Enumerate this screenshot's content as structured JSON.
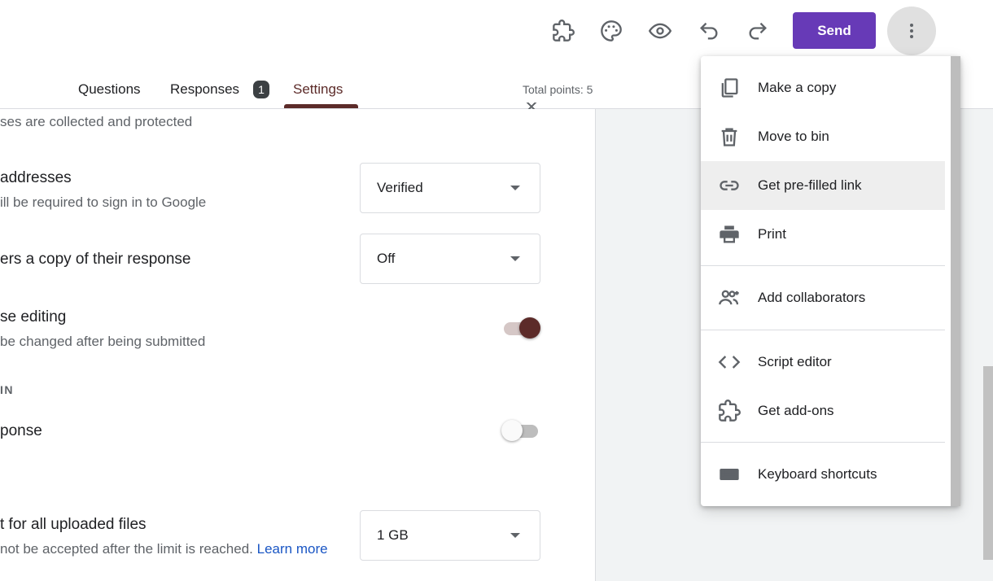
{
  "header": {
    "send_label": "Send",
    "icons": [
      "addons-icon",
      "palette-icon",
      "preview-icon",
      "undo-icon",
      "redo-icon",
      "more-vert-icon"
    ]
  },
  "tabs": [
    {
      "label": "Questions"
    },
    {
      "label": "Responses",
      "badge": "1"
    },
    {
      "label": "Settings",
      "active": true
    }
  ],
  "total_points": "Total points: 5",
  "settings": {
    "collect_sub": "ses are collected and protected",
    "email_title": "addresses",
    "email_sub": "ill be required to sign in to Google",
    "email_value": "Verified",
    "copy_title": "ers a copy of their response",
    "copy_value": "Off",
    "edit_title": "se editing",
    "edit_sub": " be changed after being submitted",
    "edit_on": true,
    "section_label": "IN",
    "response_title": "ponse",
    "response_on": false,
    "upload_title": "t for all uploaded files",
    "upload_sub": "not be accepted after the limit is reached.",
    "upload_link": "Learn more",
    "upload_value": "1 GB"
  },
  "menu": {
    "items": [
      {
        "label": "Make a copy",
        "icon": "copy-icon"
      },
      {
        "label": "Move to bin",
        "icon": "bin-icon"
      },
      {
        "label": "Get pre-filled link",
        "icon": "link-icon",
        "highlighted": true
      },
      {
        "label": "Print",
        "icon": "print-icon"
      },
      {
        "label": "Add collaborators",
        "icon": "add-people-icon"
      },
      {
        "label": "Script editor",
        "icon": "code-icon"
      },
      {
        "label": "Get add-ons",
        "icon": "addons-icon"
      },
      {
        "label": "Keyboard shortcuts",
        "icon": "keyboard-icon"
      }
    ]
  },
  "colors": {
    "accent": "#673ab7",
    "toggle_on": "#5c2b29",
    "link": "#1a56c4"
  }
}
